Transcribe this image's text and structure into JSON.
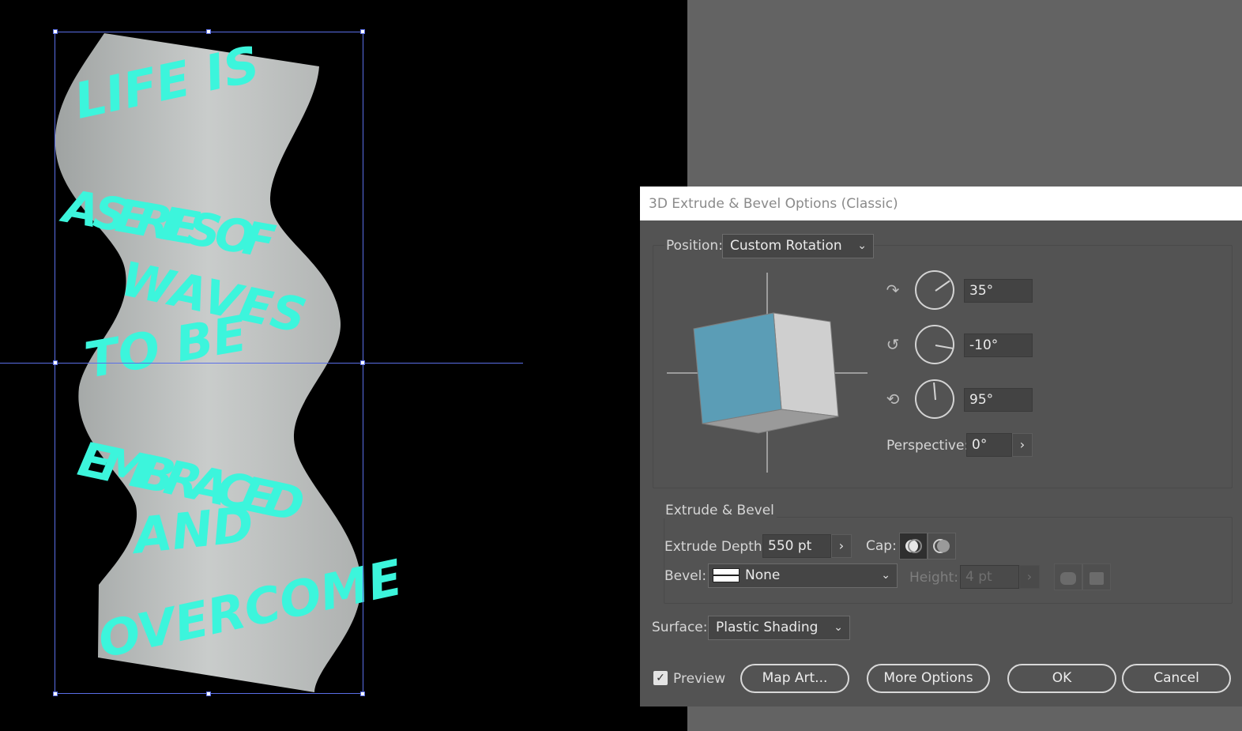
{
  "canvas": {
    "artwork_lines": [
      "LIFE IS",
      "A SERIES OF",
      "WAVES",
      "TO BE",
      "EMBRACED",
      "AND",
      "OVERCOME"
    ],
    "text_color": "#3cf5dc",
    "guide_color": "#5a6ee6"
  },
  "dialog": {
    "title": "3D Extrude & Bevel Options (Classic)",
    "position": {
      "label": "Position:",
      "value": "Custom Rotation",
      "x_rotation": "35°",
      "y_rotation": "-10°",
      "z_rotation": "95°",
      "x_icon": "rotate-x-axis-icon",
      "y_icon": "rotate-y-axis-icon",
      "z_icon": "rotate-z-axis-icon",
      "perspective_label": "Perspective:",
      "perspective_value": "0°"
    },
    "extrude": {
      "section_label": "Extrude & Bevel",
      "depth_label": "Extrude Depth:",
      "depth_value": "550 pt",
      "cap_label": "Cap:",
      "bevel_label": "Bevel:",
      "bevel_value": "None",
      "height_label": "Height:",
      "height_value": "4 pt"
    },
    "surface": {
      "label": "Surface:",
      "value": "Plastic Shading"
    },
    "preview_label": "Preview",
    "preview_checked": true,
    "buttons": {
      "map_art": "Map Art...",
      "more_options": "More Options",
      "ok": "OK",
      "cancel": "Cancel"
    }
  },
  "colors": {
    "cube_front": "#5b9db6",
    "cube_side": "#cfcfcf",
    "cube_bottom": "#9a9a9a",
    "dialog_bg": "#535353"
  }
}
